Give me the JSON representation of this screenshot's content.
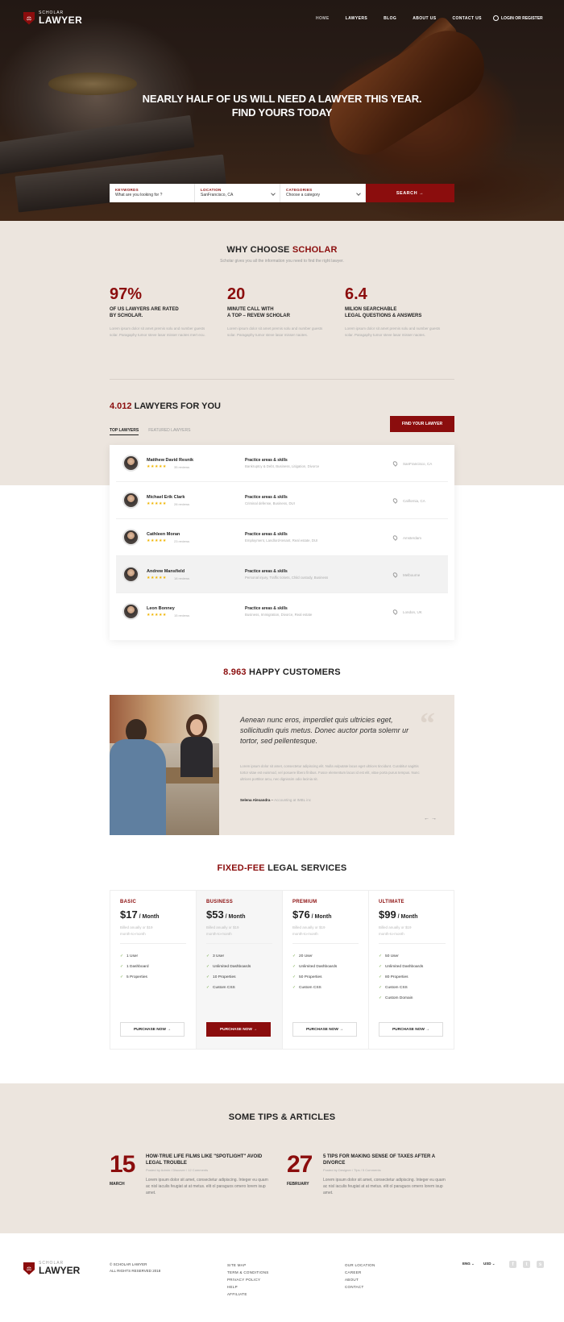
{
  "nav": {
    "logo_small": "SCHOLAR",
    "logo_big": "LAWYER",
    "items": [
      "HOME",
      "LAWYERS",
      "BLOG",
      "ABOUT US",
      "CONTACT US"
    ],
    "login": "LOGIN OR REGISTER"
  },
  "hero": {
    "title_line1": "NEARLY HALF OF US WILL NEED A LAWYER THIS YEAR.",
    "title_line2": "FIND YOURS TODAY"
  },
  "search": {
    "keywords_label": "KEYWORDS",
    "keywords_value": "What are you looking for ?",
    "location_label": "LOCATION",
    "location_value": "SanFrancisco, CA",
    "categories_label": "CATEGORIES",
    "categories_value": "Choose a category",
    "button": "SEARCH"
  },
  "why": {
    "title_a": "WHY CHOOSE",
    "title_b": "SCHOLAR",
    "subtitle": "Scholar gives you all the information you need to find the right lawyer.",
    "stats": [
      {
        "num": "97%",
        "line1": "OF US LAWYERS ARE RATED",
        "line2": "BY SCHOLAR.",
        "desc": "Lorem ipsum dolor sit amet premis solu and number guests solar. Paragaphy tumor steve lasar misser naotes mert ecu."
      },
      {
        "num": "20",
        "line1": "MINUTE CALL WITH",
        "line2": "A TOP – REVEW SCHOLAR",
        "desc": "Lorem ipsum dolor sit amet premis solu and number guests solar. Paragaphy tumor steve lasar misser naotes."
      },
      {
        "num": "6.4",
        "line1": "MILION SEARCHABLE",
        "line2": "LEGAL QUESTIONS & ANSWERS",
        "desc": "Lorem ipsum dolor sit amet premis solu and number guests solar. Paragaphy tumor steve lasar misser naotes."
      }
    ]
  },
  "lawyers": {
    "count": "4.012",
    "title": "LAWYERS FOR YOU",
    "tab_top": "TOP LAWYERS",
    "tab_featured": "FEATURED LAWYERS",
    "find_button": "FIND YOUR LAWYER",
    "rows": [
      {
        "name": "Matthew David Resnik",
        "stars": "★★★★★",
        "reviews": "35 reviews",
        "pa": "Practice areas & skills",
        "skills": "Bankruptcy & Debt, Business, Litigation, Divorce",
        "location": "SanFrancisco, CA"
      },
      {
        "name": "Michael Erik Clark",
        "stars": "★★★★★",
        "reviews": "28 reviews",
        "pa": "Practice areas & skills",
        "skills": "Criminal defense, Business, DUI",
        "location": "California, CA"
      },
      {
        "name": "Cathleen Moran",
        "stars": "★★★★★",
        "reviews": "23 reviews",
        "pa": "Practice areas & skills",
        "skills": "Employment, Landlord-tenant, Real estate, DUI",
        "location": "Amsterdam"
      },
      {
        "name": "Andrew Mansfield",
        "stars": "★★★★★",
        "reviews": "18 reviews",
        "pa": "Practice areas & skills",
        "skills": "Personal injury, Traffic tickets, Child custody, Business",
        "location": "Melbourne"
      },
      {
        "name": "Leon Bonney",
        "stars": "★★★★★",
        "reviews": "15 reviews",
        "pa": "Practice areas & skills",
        "skills": "Business, Immigration, Divorce, Real estate",
        "location": "London, UK"
      }
    ]
  },
  "happy": {
    "count": "8.963",
    "title": "HAPPY CUSTOMERS",
    "quote": "Aenean nunc eros, imperdiet quis ultricies eget, sollicitudin quis metus. Donec auctor porta solemr ur tortor, sed pellentesque.",
    "body": "Lorem ipsum dolor sit amet, consectetur adipiscing elit. Nulla vulputate lacus eget ultrices tincidunt. Curabitur sagittis tortor vitae est euismod, vel posuere libero finibus. Fusce elementum lacus id est elit, vitae porta purus tempus. Nunc ultrices porttitor arcu, nec dignissim odio lacinia sit.",
    "author": "Selena Alexandra",
    "role": "Accounting at IMBL inc",
    "arrows": "← →"
  },
  "pricing": {
    "title_a": "FIXED-FEE",
    "title_b": "LEGAL SERVICES",
    "plans": [
      {
        "name": "BASIC",
        "price": "$17",
        "per": " / Month",
        "bill1": "Billed anually or $19",
        "bill2": "month-to-month",
        "f": [
          "1 User",
          "1 Dashboard",
          "5 Properties",
          "",
          ""
        ],
        "btn": "PURCHASE NOW →"
      },
      {
        "name": "BUSINESS",
        "price": "$53",
        "per": " / Month",
        "bill1": "Billed anually or $19",
        "bill2": "month-to-month",
        "f": [
          "3 User",
          "Unlimited Dashboards",
          "10 Properties",
          "Custom CSS",
          ""
        ],
        "btn": "PURCHASE NOW →"
      },
      {
        "name": "PREMIUM",
        "price": "$76",
        "per": " / Month",
        "bill1": "Billed anually or $19",
        "bill2": "month-to-month",
        "f": [
          "20 User",
          "Unlimited Dashboards",
          "50 Properties",
          "Custom CSS",
          ""
        ],
        "btn": "PURCHASE NOW →"
      },
      {
        "name": "ULTIMATE",
        "price": "$99",
        "per": " / Month",
        "bill1": "Billed anually or $19",
        "bill2": "month-to-month",
        "f": [
          "50 User",
          "Unlimited Dashboards",
          "80 Properties",
          "Custom CSS",
          "Custom Domain"
        ],
        "btn": "PURCHASE NOW →"
      }
    ]
  },
  "tips": {
    "title": "SOME TIPS & ARTICLES",
    "articles": [
      {
        "day": "15",
        "month": "MARCH",
        "title": "HOW-TRUE LIFE FILMS LIKE \"SPOTLIGHT\" AVOID LEGAL TROUBLE",
        "meta": "Posted by Admin  /  Discover  /  12 Comments",
        "body": "Lorem ipsum dolor sit amet, consectetur adipiscing. Integer eu quam ac nisl iaculis feugiat at at metus.  elit ol paraguos omero lorem isup amet."
      },
      {
        "day": "27",
        "month": "FEBRUARY",
        "title": "5 TIPS FOR MAKING SENSE OF TAXES AFTER A DIVORCE",
        "meta": "Posted by Designer  /  Tips  /  5 Comments",
        "body": "Lorem ipsum dolor sit amet, consectetur adipiscing. Integer eu quam ac nisl iaculis feugiat at at metus.  elit ol paraguos omero lorem isup amet."
      }
    ]
  },
  "footer": {
    "copy1": "© SCHOLAR LAWYER",
    "copy2": "ALL RIGHTS RESERVED 2018",
    "col1": [
      "SITE MAP",
      "TERM & CONDITIONS",
      "PRIVACY POLICY",
      "HELP",
      "AFFILIATE"
    ],
    "col2": [
      "OUR LOCATION",
      "CAREER",
      "ABOUT",
      "CONTACT"
    ],
    "lang": "ENG",
    "currency": "USD",
    "social": [
      "f",
      "t",
      "s"
    ]
  }
}
